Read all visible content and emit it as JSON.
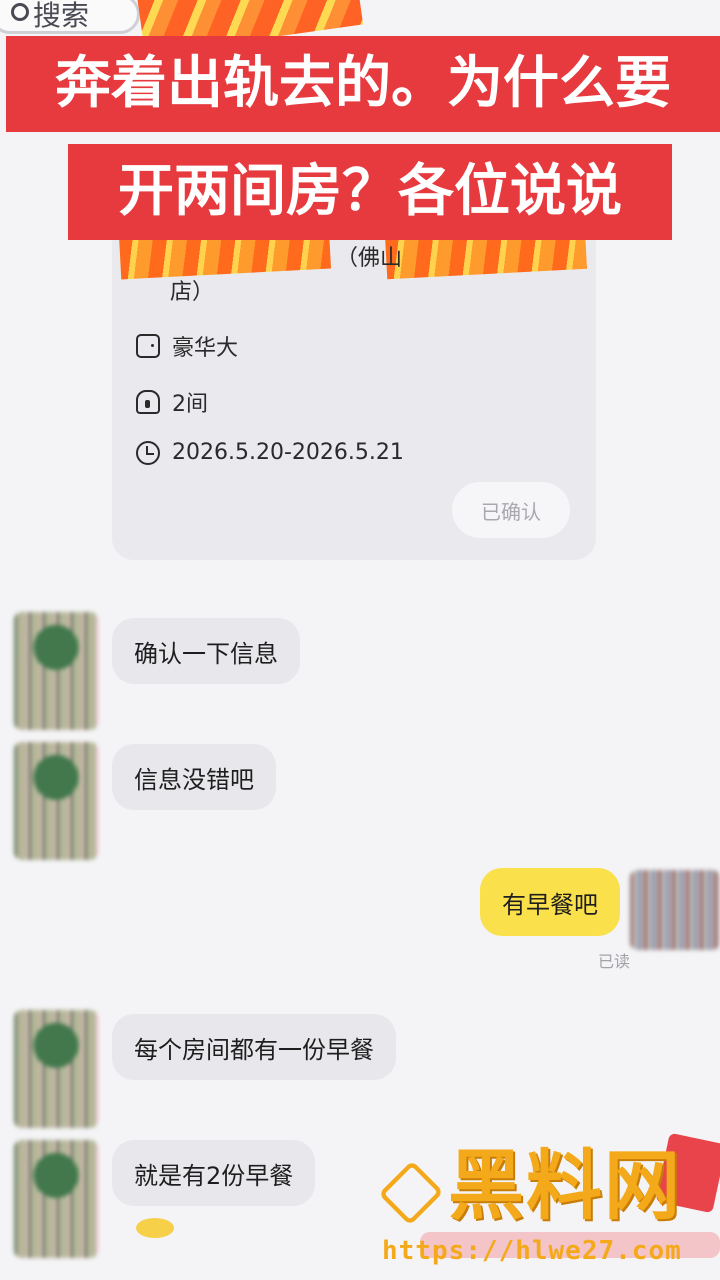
{
  "search": {
    "label": "搜索"
  },
  "banner": {
    "line1": "奔着出轨去的。为什么要",
    "line2": "开两间房？各位说说"
  },
  "booking_card": {
    "hotel_name_fragment": "（佛山",
    "hotel_name_continued": "店）",
    "room_type": "豪华大",
    "room_count": "2间",
    "date_range": "2026.5.20-2026.5.21",
    "status_button": "已确认"
  },
  "messages": [
    {
      "side": "left",
      "text": "确认一下信息"
    },
    {
      "side": "left",
      "text": "信息没错吧"
    },
    {
      "side": "right",
      "text": "有早餐吧",
      "read_status": "已读"
    },
    {
      "side": "left",
      "text": "每个房间都有一份早餐"
    },
    {
      "side": "left",
      "text": "就是有2份早餐"
    }
  ],
  "watermark": {
    "title": "黑料网",
    "url": "https://hlwe27.com"
  },
  "colors": {
    "banner_red": "#e63a3f",
    "my_bubble": "#fae14b",
    "their_bubble": "#e8e8ec",
    "card_bg": "#e9e9ee",
    "watermark": "#f4a91a"
  }
}
